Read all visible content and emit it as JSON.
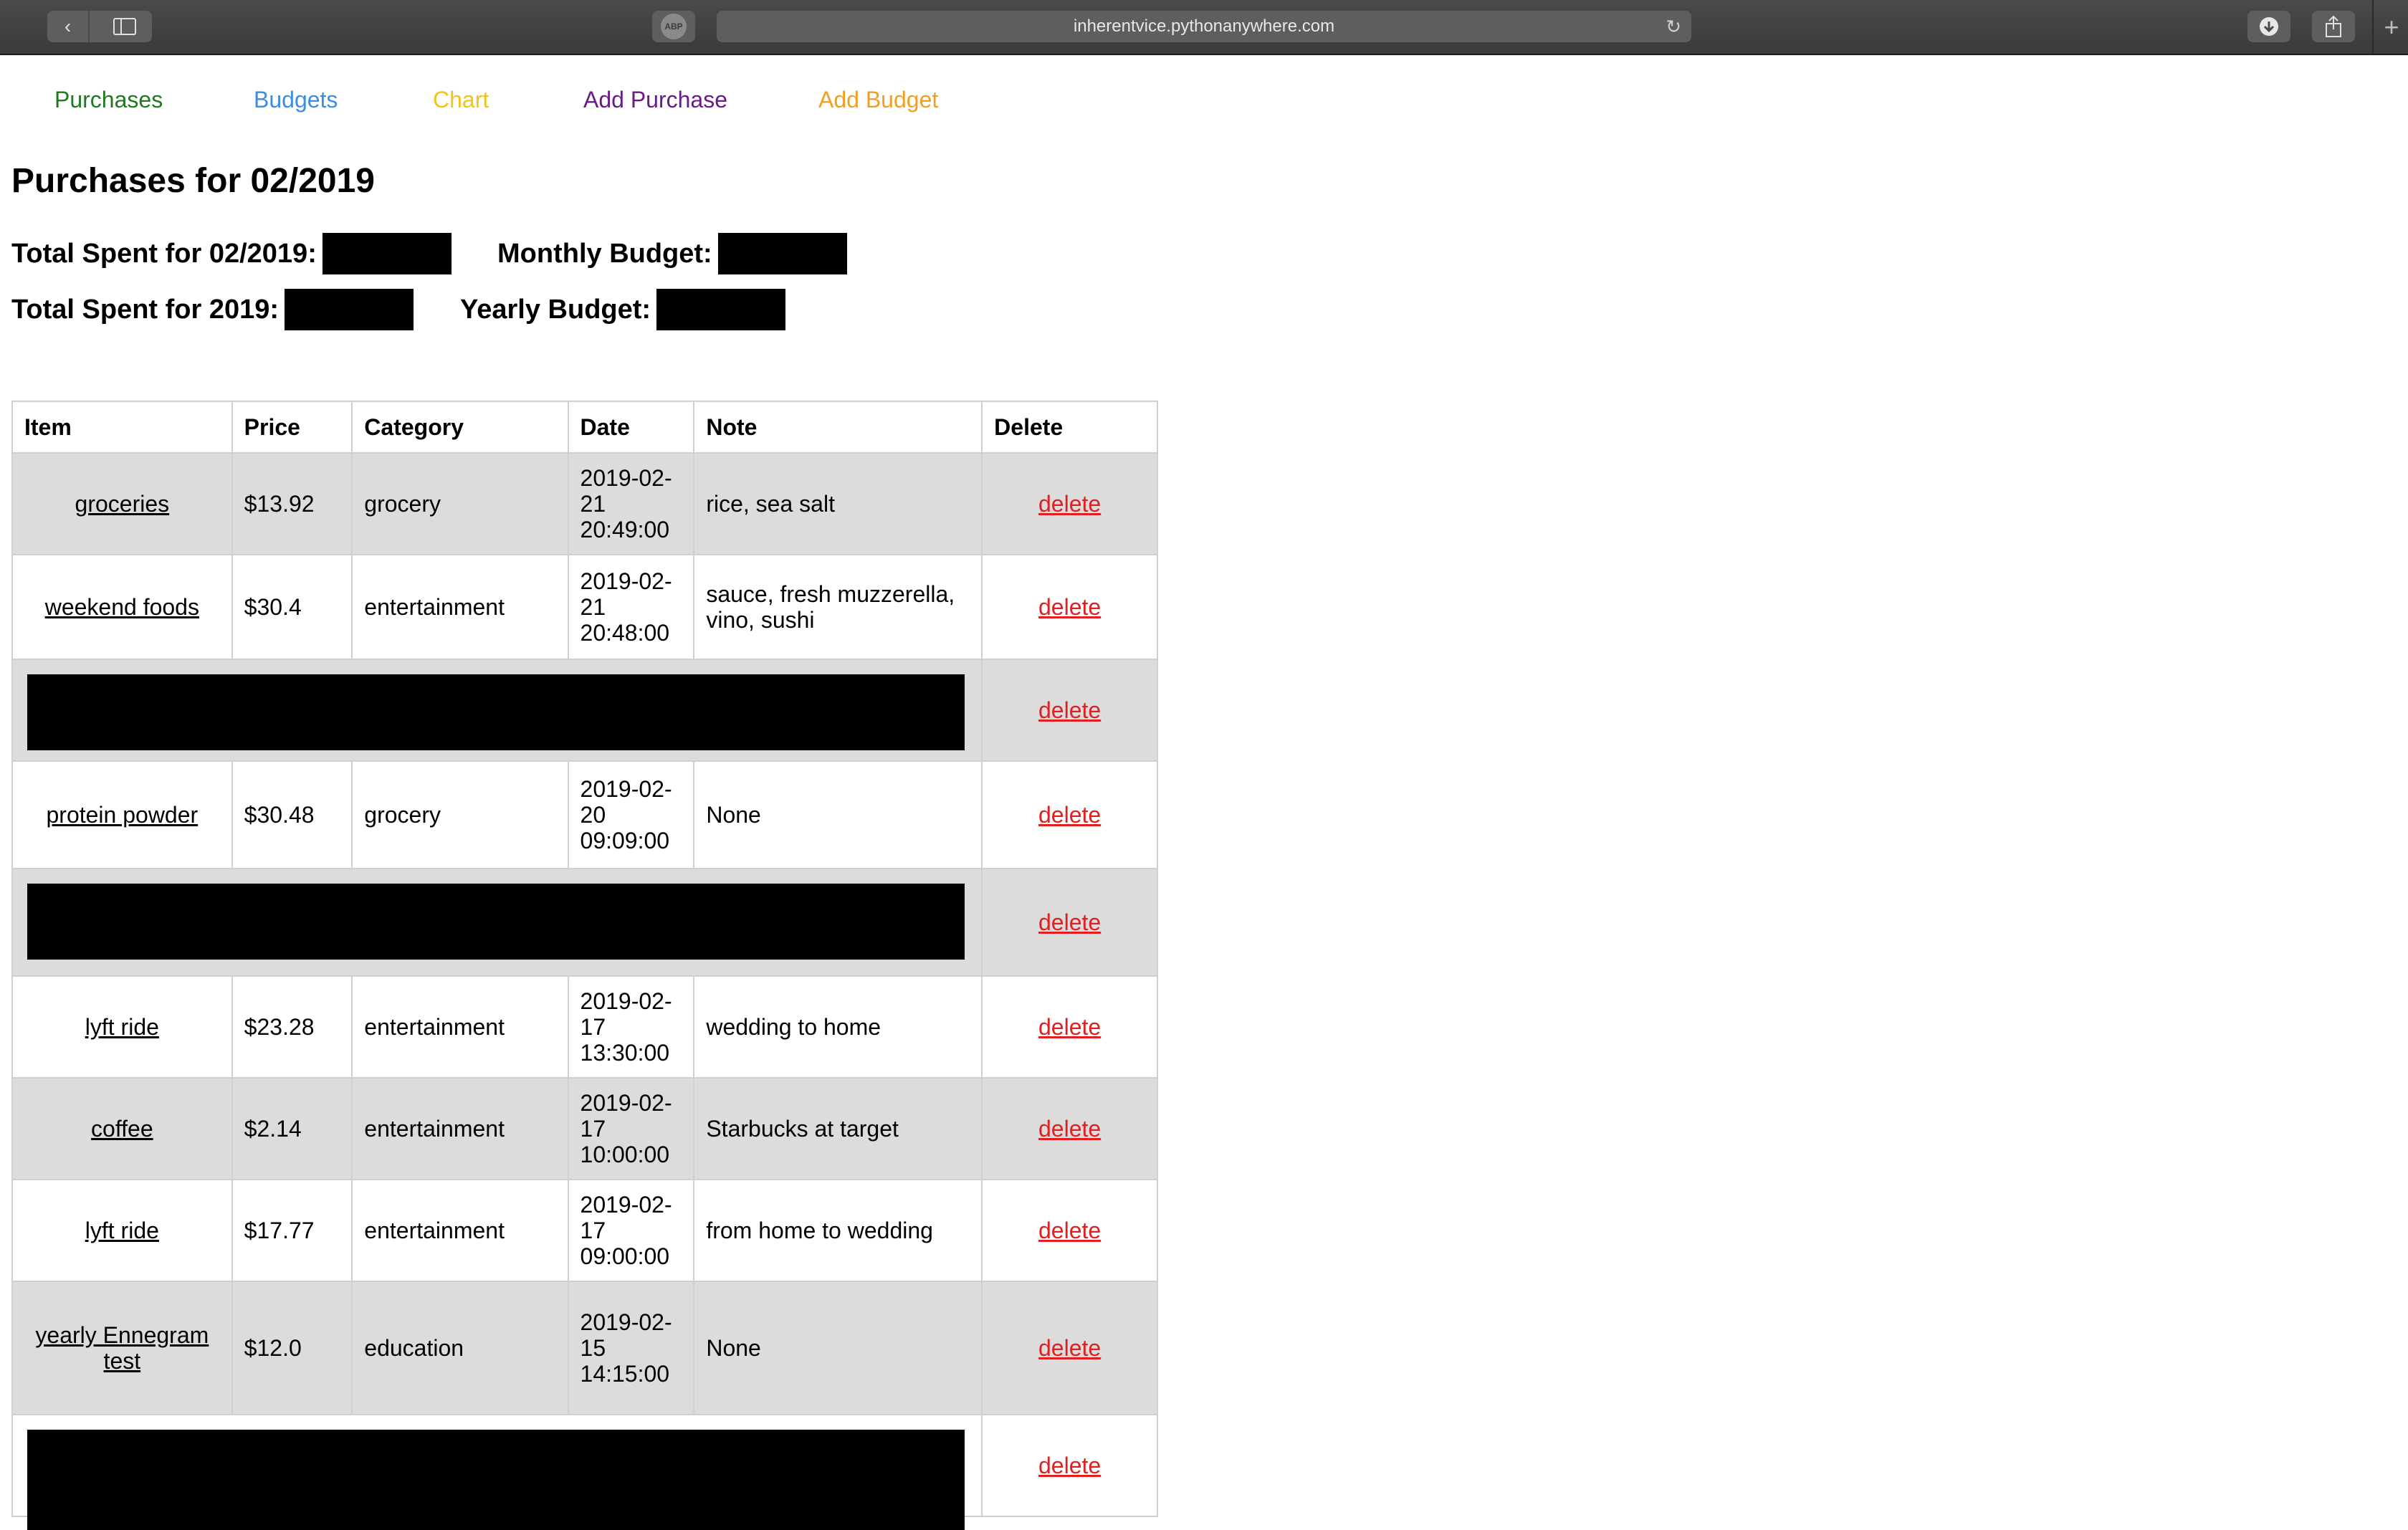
{
  "browser": {
    "url": "inherentvice.pythonanywhere.com"
  },
  "nav": [
    {
      "label": "Purchases",
      "color": "#1e7a1e"
    },
    {
      "label": "Budgets",
      "color": "#3a8ee6"
    },
    {
      "label": "Chart",
      "color": "#f0c419"
    },
    {
      "label": "Add Purchase",
      "color": "#6a1b8a"
    },
    {
      "label": "Add Budget",
      "color": "#f0a020"
    }
  ],
  "page_title": "Purchases for 02/2019",
  "stats": {
    "month_spent_label": "Total Spent for 02/2019:",
    "monthly_budget_label": "Monthly Budget:",
    "year_spent_label": "Total Spent for 2019:",
    "yearly_budget_label": "Yearly Budget:"
  },
  "table": {
    "headers": [
      "Item",
      "Price",
      "Category",
      "Date",
      "Note",
      "Delete"
    ],
    "delete_label": "delete",
    "rows": [
      {
        "item": "groceries",
        "price": "$13.92",
        "category": "grocery",
        "date": "2019-02-21 20:49:00",
        "note": "rice, sea salt"
      },
      {
        "item": "weekend foods",
        "price": "$30.4",
        "category": "entertainment",
        "date": "2019-02-21 20:48:00",
        "note": "sauce, fresh muzzerella, vino, sushi"
      },
      {
        "redacted": true
      },
      {
        "item": "protein powder",
        "price": "$30.48",
        "category": "grocery",
        "date": "2019-02-20 09:09:00",
        "note": "None"
      },
      {
        "redacted": true
      },
      {
        "item": "lyft ride",
        "price": "$23.28",
        "category": "entertainment",
        "date": "2019-02-17 13:30:00",
        "note": "wedding to home"
      },
      {
        "item": "coffee",
        "price": "$2.14",
        "category": "entertainment",
        "date": "2019-02-17 10:00:00",
        "note": "Starbucks at target"
      },
      {
        "item": "lyft ride",
        "price": "$17.77",
        "category": "entertainment",
        "date": "2019-02-17 09:00:00",
        "note": "from home to wedding"
      },
      {
        "item": "yearly Ennegram test",
        "price": "$12.0",
        "category": "education",
        "date": "2019-02-15 14:15:00",
        "note": "None"
      },
      {
        "redacted": true
      }
    ]
  }
}
